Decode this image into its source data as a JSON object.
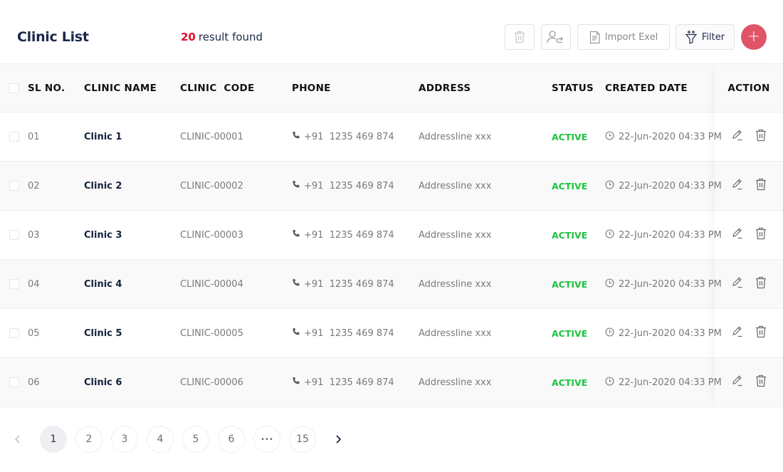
{
  "header": {
    "title": "Clinic List",
    "result_count": "20",
    "result_label": "result found",
    "import_label": "Import Exel",
    "filter_label": "Filter",
    "add_label": "+"
  },
  "colors": {
    "accent": "#e05468",
    "count": "#e0112b",
    "status_active": "#1cc43f",
    "title": "#1b2a4a"
  },
  "table": {
    "columns": [
      "SL NO.",
      "CLINIC NAME",
      "CLINIC  CODE",
      "PHONE",
      "ADDRESS",
      "STATUS",
      "CREATED DATE",
      "ACTION"
    ],
    "rows": [
      {
        "sl": "01",
        "name": "Clinic 1",
        "code": "CLINIC-00001",
        "phone": "+91  1235 469 874",
        "address": "Addressline xxx",
        "status": "ACTIVE",
        "created": "22-Jun-2020 04:33 PM"
      },
      {
        "sl": "02",
        "name": "Clinic 2",
        "code": "CLINIC-00002",
        "phone": "+91  1235 469 874",
        "address": "Addressline xxx",
        "status": "ACTIVE",
        "created": "22-Jun-2020 04:33 PM"
      },
      {
        "sl": "03",
        "name": "Clinic 3",
        "code": "CLINIC-00003",
        "phone": "+91  1235 469 874",
        "address": "Addressline xxx",
        "status": "ACTIVE",
        "created": "22-Jun-2020 04:33 PM"
      },
      {
        "sl": "04",
        "name": "Clinic 4",
        "code": "CLINIC-00004",
        "phone": "+91  1235 469 874",
        "address": "Addressline xxx",
        "status": "ACTIVE",
        "created": "22-Jun-2020 04:33 PM"
      },
      {
        "sl": "05",
        "name": "Clinic 5",
        "code": "CLINIC-00005",
        "phone": "+91  1235 469 874",
        "address": "Addressline xxx",
        "status": "ACTIVE",
        "created": "22-Jun-2020 04:33 PM"
      },
      {
        "sl": "06",
        "name": "Clinic 6",
        "code": "CLINIC-00006",
        "phone": "+91  1235 469 874",
        "address": "Addressline xxx",
        "status": "ACTIVE",
        "created": "22-Jun-2020 04:33 PM"
      }
    ]
  },
  "pagination": {
    "pages": [
      "1",
      "2",
      "3",
      "4",
      "5",
      "6",
      "•••",
      "15"
    ],
    "current": "1",
    "prev_icon": "chevron-left-icon",
    "next_icon": "chevron-right-icon"
  }
}
